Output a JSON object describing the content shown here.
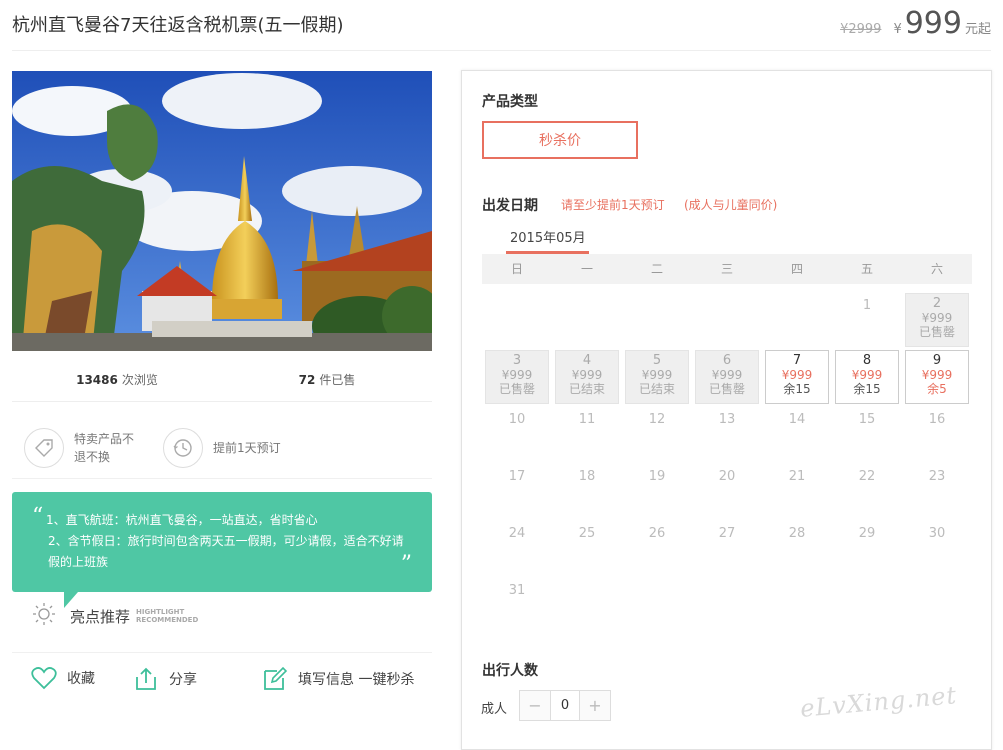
{
  "product": {
    "title": "杭州直飞曼谷7天往返含税机票(五一假期)",
    "original_price": "¥2999",
    "currency_symbol": "¥",
    "price": "999",
    "price_suffix": "元起"
  },
  "stats": {
    "views_count": "13486",
    "views_label": "次浏览",
    "sold_count": "72",
    "sold_label": "件已售"
  },
  "features": [
    {
      "icon": "tag-icon",
      "text": "特卖产品不退不换"
    },
    {
      "icon": "clock-icon",
      "text": "提前1天预订"
    }
  ],
  "highlights": {
    "line1": "1、直飞航班：杭州直飞曼谷，一站直达，省时省心",
    "line2": "2、含节假日：旅行时间包含两天五一假期，可少请假，适合不好请假的上班族",
    "title": "亮点推荐",
    "subtitle_1": "HIGHTLIGHT",
    "subtitle_2": "RECOMMENDED"
  },
  "actions": {
    "favorite": "收藏",
    "share": "分享",
    "book": "填写信息 一键秒杀"
  },
  "booking": {
    "product_type_label": "产品类型",
    "product_type_option": "秒杀价",
    "departure_label": "出发日期",
    "hint_advance": "请至少提前1天预订",
    "hint_child": "(成人与儿童同价)",
    "month": "2015年05月",
    "weekdays": [
      "日",
      "一",
      "二",
      "三",
      "四",
      "五",
      "六"
    ],
    "travelers_label": "出行人数",
    "adult_label": "成人",
    "adult_count": "0",
    "minus": "−",
    "plus": "+"
  },
  "calendar": {
    "weeks": [
      [
        null,
        null,
        null,
        null,
        null,
        {
          "day": "1"
        },
        {
          "day": "2",
          "price": "¥999",
          "status": "已售罄",
          "state": "grey"
        }
      ],
      [
        {
          "day": "3",
          "price": "¥999",
          "status": "已售罄",
          "state": "grey"
        },
        {
          "day": "4",
          "price": "¥999",
          "status": "已结束",
          "state": "grey"
        },
        {
          "day": "5",
          "price": "¥999",
          "status": "已结束",
          "state": "grey"
        },
        {
          "day": "6",
          "price": "¥999",
          "status": "已售罄",
          "state": "grey"
        },
        {
          "day": "7",
          "price": "¥999",
          "status": "余15",
          "state": "avail"
        },
        {
          "day": "8",
          "price": "¥999",
          "status": "余15",
          "state": "avail"
        },
        {
          "day": "9",
          "price": "¥999",
          "status": "余5",
          "state": "avail-low"
        }
      ],
      [
        {
          "day": "10"
        },
        {
          "day": "11"
        },
        {
          "day": "12"
        },
        {
          "day": "13"
        },
        {
          "day": "14"
        },
        {
          "day": "15"
        },
        {
          "day": "16"
        }
      ],
      [
        {
          "day": "17"
        },
        {
          "day": "18"
        },
        {
          "day": "19"
        },
        {
          "day": "20"
        },
        {
          "day": "21"
        },
        {
          "day": "22"
        },
        {
          "day": "23"
        }
      ],
      [
        {
          "day": "24"
        },
        {
          "day": "25"
        },
        {
          "day": "26"
        },
        {
          "day": "27"
        },
        {
          "day": "28"
        },
        {
          "day": "29"
        },
        {
          "day": "30"
        }
      ],
      [
        {
          "day": "31"
        },
        null,
        null,
        null,
        null,
        null,
        null
      ]
    ]
  },
  "watermark": "eLvXing.net",
  "colors": {
    "accent": "#e8705f",
    "teal": "#4fc7a4",
    "icon_teal": "#3dbf9a"
  }
}
